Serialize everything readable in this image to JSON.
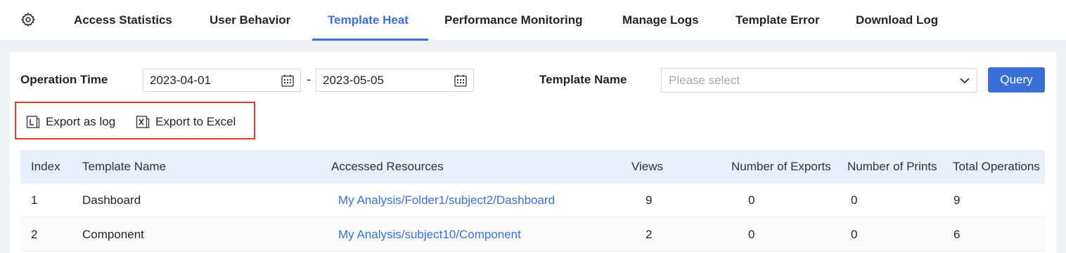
{
  "tabs": [
    {
      "label": "Access Statistics",
      "active": false
    },
    {
      "label": "User Behavior",
      "active": false
    },
    {
      "label": "Template Heat",
      "active": true
    },
    {
      "label": "Performance Monitoring",
      "active": false
    },
    {
      "label": "Manage Logs",
      "active": false
    },
    {
      "label": "Template Error",
      "active": false
    },
    {
      "label": "Download Log",
      "active": false
    }
  ],
  "icons": {
    "settings": "gear-icon",
    "calendar": "calendar-icon",
    "dropdown": "chevron-down-icon",
    "export_log": "log-file-icon",
    "export_excel": "excel-file-icon"
  },
  "filters": {
    "operation_time_label": "Operation Time",
    "start_date": "2023-04-01",
    "separator": "-",
    "end_date": "2023-05-05",
    "template_name_label": "Template Name",
    "template_placeholder": "Please select",
    "query_label": "Query"
  },
  "export": {
    "log_label": "Export as log",
    "excel_label": "Export to Excel"
  },
  "table": {
    "columns": [
      "Index",
      "Template Name",
      "Accessed Resources",
      "Views",
      "Number of Exports",
      "Number of Prints",
      "Total Operations"
    ],
    "rows": [
      {
        "index": "1",
        "template_name": "Dashboard",
        "resource": "My Analysis/Folder1/subject2/Dashboard",
        "views": "9",
        "exports": "0",
        "prints": "0",
        "total": "9"
      },
      {
        "index": "2",
        "template_name": "Component",
        "resource": "My Analysis/subject10/Component",
        "views": "2",
        "exports": "0",
        "prints": "0",
        "total": "6"
      }
    ]
  },
  "colors": {
    "accent": "#3a6fd8",
    "highlight_border": "#e53935",
    "table_header_bg": "#e8f0fc"
  }
}
